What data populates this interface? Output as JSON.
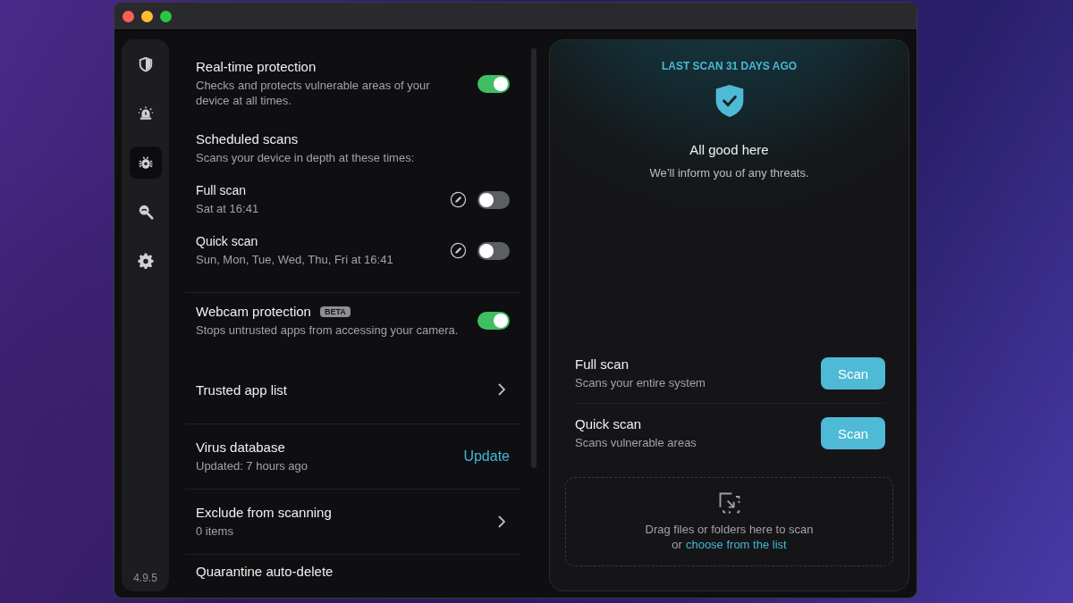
{
  "sidebar": {
    "items": [
      {
        "selected": false
      },
      {
        "selected": false
      },
      {
        "selected": true
      },
      {
        "selected": false
      },
      {
        "selected": false
      }
    ],
    "version": "4.9.5"
  },
  "settings": [
    {
      "kind": "toggle",
      "title": "Real-time protection",
      "description": "Checks and protects vulnerable areas of your device at all times.",
      "on": true
    },
    {
      "kind": "header",
      "title": "Scheduled scans",
      "description": "Scans your device in depth at these times:"
    },
    {
      "kind": "schedule",
      "title": "Full scan",
      "description": "Sat at 16:41",
      "on": false
    },
    {
      "kind": "schedule",
      "title": "Quick scan",
      "description": "Sun, Mon, Tue, Wed, Thu, Fri at 16:41",
      "on": false
    },
    {
      "kind": "toggle",
      "title": "Webcam protection",
      "badge": "BETA",
      "description": "Stops untrusted apps from accessing your camera.",
      "on": true
    },
    {
      "kind": "link",
      "title": "Trusted app list"
    },
    {
      "kind": "action",
      "title": "Virus database",
      "description": "Updated: 7 hours ago",
      "action": "Update"
    },
    {
      "kind": "link",
      "title": "Exclude from scanning",
      "description": "0 items"
    },
    {
      "kind": "plain",
      "title": "Quarantine auto-delete"
    }
  ],
  "status": {
    "caption": "LAST SCAN 31 DAYS AGO",
    "title": "All good here",
    "subtitle": "We’ll inform you of any threats."
  },
  "scans": [
    {
      "title": "Full scan",
      "description": "Scans your entire system",
      "button": "Scan"
    },
    {
      "title": "Quick scan",
      "description": "Scans vulnerable areas",
      "button": "Scan"
    }
  ],
  "dropzone": {
    "text": "Drag files or folders here to scan",
    "prefix": "or",
    "link": "choose from the list"
  }
}
